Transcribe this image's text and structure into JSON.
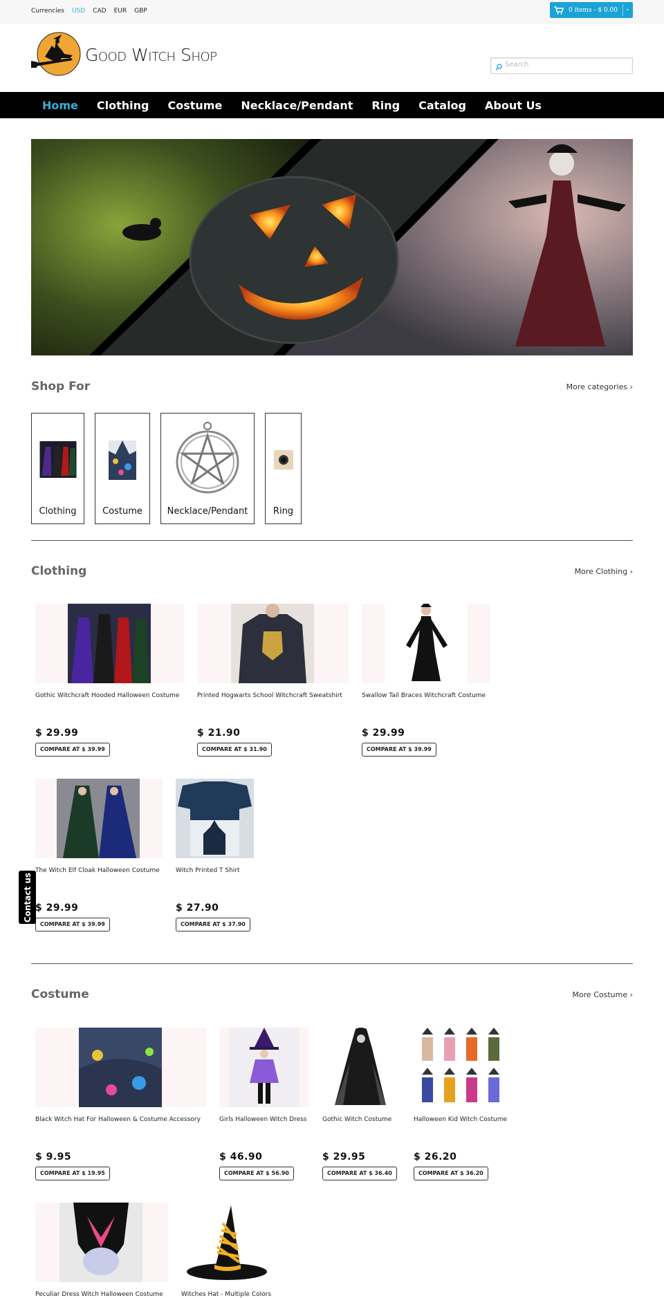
{
  "topbar": {
    "currencies_label": "Currencies",
    "currencies": [
      "USD",
      "CAD",
      "EUR",
      "GBP"
    ],
    "active_currency": "USD",
    "cart_label": "0 items - $ 0.00"
  },
  "header": {
    "logo_text": "Good Witch Shop",
    "search_placeholder": "Search"
  },
  "nav": {
    "items": [
      "Home",
      "Clothing",
      "Costume",
      "Necklace/Pendant",
      "Ring",
      "Catalog",
      "About Us"
    ],
    "active": "Home"
  },
  "shop_for": {
    "title": "Shop For",
    "more": "More categories ›",
    "categories": [
      "Clothing",
      "Costume",
      "Necklace/Pendant",
      "Ring"
    ]
  },
  "clothing": {
    "title": "Clothing",
    "more": "More Clothing ›",
    "products": [
      {
        "name": "Gothic Witchcraft Hooded Halloween Costume",
        "price": "$ 29.99",
        "compare": "COMPARE AT $ 39.99"
      },
      {
        "name": "Printed Hogwarts School Witchcraft Sweatshirt",
        "price": "$ 21.90",
        "compare": "COMPARE AT $ 31.90"
      },
      {
        "name": "Swallow Tail Braces Witchcraft Costume",
        "price": "$ 29.99",
        "compare": "COMPARE AT $ 39.99"
      },
      {
        "name": "The Witch Elf Cloak Halloween Costume",
        "price": "$ 29.99",
        "compare": "COMPARE AT $ 39.99"
      },
      {
        "name": "Witch Printed T Shirt",
        "price": "$ 27.90",
        "compare": "COMPARE AT $ 37.90"
      }
    ]
  },
  "costume": {
    "title": "Costume",
    "more": "More Costume ›",
    "products": [
      {
        "name": "Black Witch Hat For Halloween & Costume Accessory",
        "price": "$ 9.95",
        "compare": "COMPARE AT $ 19.95"
      },
      {
        "name": "Girls Halloween Witch Dress",
        "price": "$ 46.90",
        "compare": "COMPARE AT $ 56.90"
      },
      {
        "name": "Gothic Witch Costume",
        "price": "$ 29.95",
        "compare": "COMPARE AT $ 36.40"
      },
      {
        "name": "Halloween Kid Witch Costume",
        "price": "$ 26.20",
        "compare": "COMPARE AT $ 36.20"
      },
      {
        "name": "Peculiar Dress Witch Halloween Costume",
        "price": "",
        "compare": ""
      },
      {
        "name": "Witches Hat - Multiple Colors",
        "price": "",
        "compare": ""
      }
    ]
  },
  "contact_tab": "Contact us",
  "colors": {
    "accent": "#1ba3d6",
    "nav_bg": "#000000",
    "nav_active": "#3aaed8"
  }
}
